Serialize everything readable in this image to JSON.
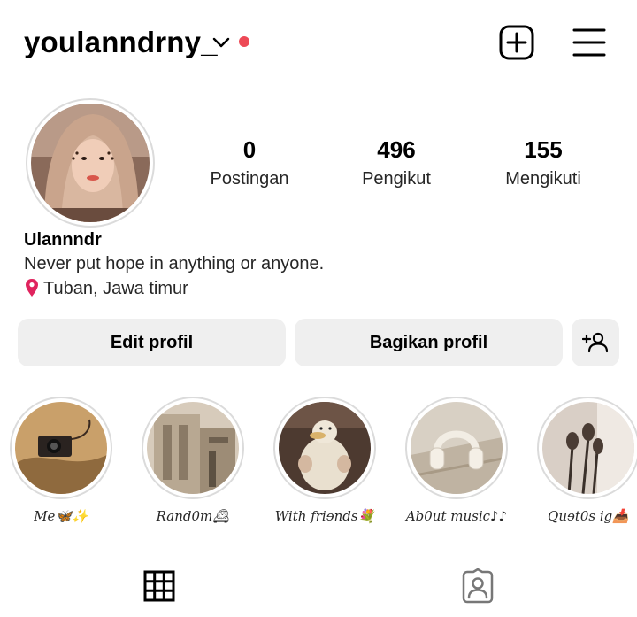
{
  "header": {
    "username": "youlanndrny_",
    "accent_notification": "#ed4956"
  },
  "stats": [
    {
      "count": "0",
      "label": "Postingan"
    },
    {
      "count": "496",
      "label": "Pengikut"
    },
    {
      "count": "155",
      "label": "Mengikuti"
    }
  ],
  "bio": {
    "name": "Ulannndr",
    "text": "Never put hope in anything or anyone.",
    "location": "Tuban, Jawa timur"
  },
  "actions": {
    "edit_label": "Edit profil",
    "share_label": "Bagikan profil"
  },
  "highlights": [
    {
      "label": "Me🦋✨"
    },
    {
      "label": "Rand0m🕰"
    },
    {
      "label": "With friɘnds💐"
    },
    {
      "label": "Ab0ut music♪♪"
    },
    {
      "label": "Quɘt0s ig📥"
    }
  ],
  "tabs": [
    {
      "icon": "grid-icon"
    },
    {
      "icon": "tagged-icon"
    }
  ]
}
